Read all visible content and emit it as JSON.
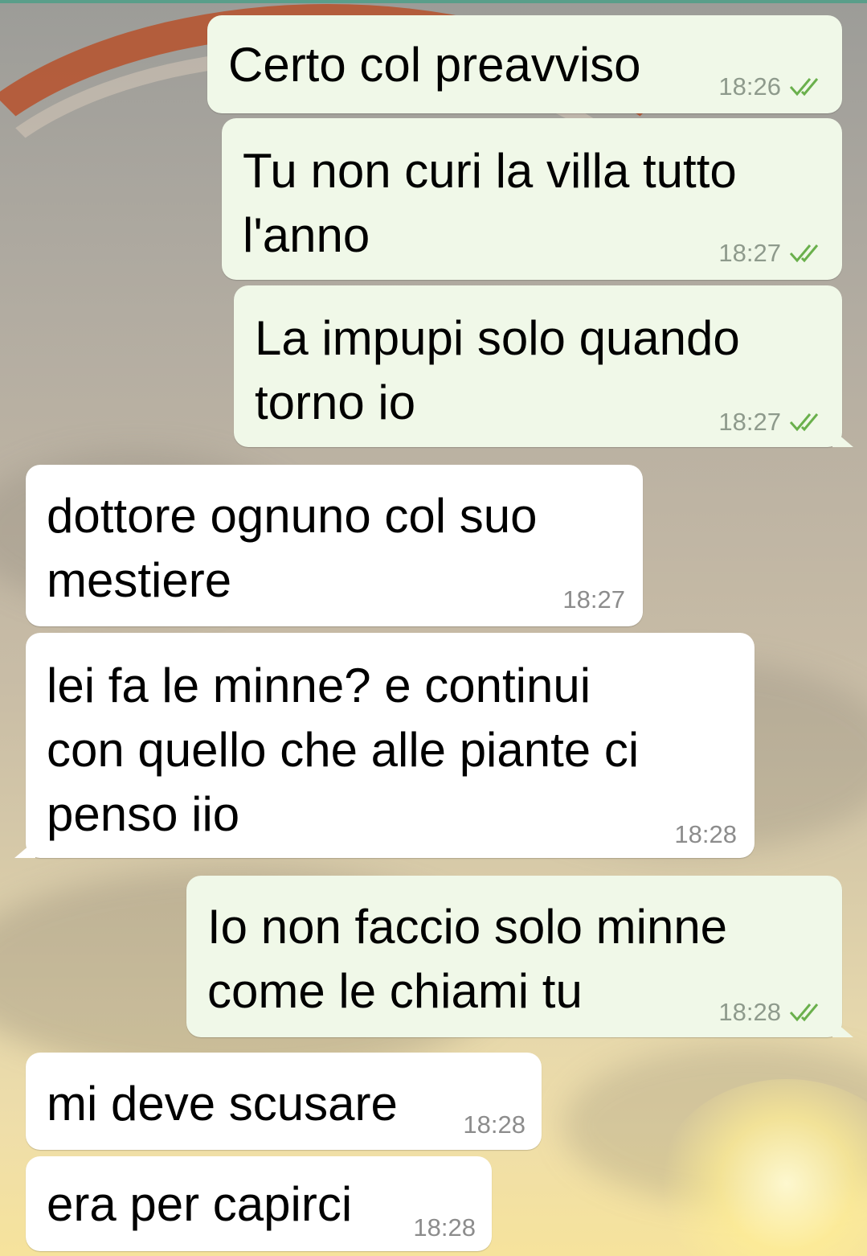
{
  "colors": {
    "outgoing_bubble": "#f0f8e8",
    "incoming_bubble": "#ffffff",
    "read_ticks": "#6ab04c",
    "timestamp_out": "#8e9a8c",
    "timestamp_in": "#8c8c8c"
  },
  "icons": {
    "read_receipt": "double-check-icon"
  },
  "messages": [
    {
      "direction": "outgoing",
      "lines": [
        "Certo col preavviso"
      ],
      "time": "18:26",
      "status": "read"
    },
    {
      "direction": "outgoing",
      "lines": [
        "Tu non curi la villa tutto",
        "l'anno"
      ],
      "time": "18:27",
      "status": "read"
    },
    {
      "direction": "outgoing",
      "lines": [
        "La impupi solo quando",
        "torno io"
      ],
      "time": "18:27",
      "status": "read"
    },
    {
      "direction": "incoming",
      "lines": [
        "dottore ognuno col suo",
        "mestiere"
      ],
      "time": "18:27"
    },
    {
      "direction": "incoming",
      "lines": [
        "lei fa le minne? e continui",
        "con quello che alle piante ci",
        "penso iio"
      ],
      "time": "18:28"
    },
    {
      "direction": "outgoing",
      "lines": [
        "Io non faccio solo minne",
        "come le chiami tu"
      ],
      "time": "18:28",
      "status": "read"
    },
    {
      "direction": "incoming",
      "lines": [
        "mi deve scusare"
      ],
      "time": "18:28"
    },
    {
      "direction": "incoming",
      "lines": [
        "era per capirci"
      ],
      "time": "18:28"
    }
  ]
}
